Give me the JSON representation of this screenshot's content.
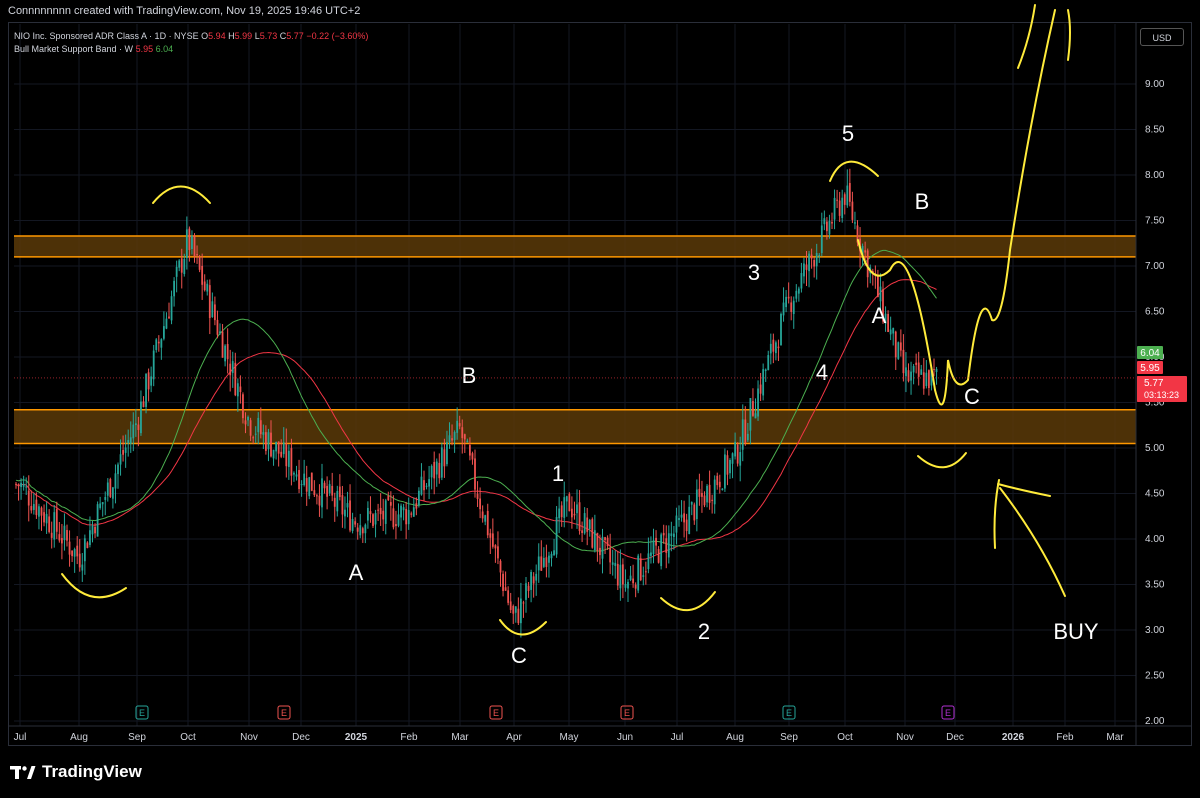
{
  "header": {
    "credit": "Connnnnnnn created with TradingView.com, Nov 19, 2025 19:46 UTC+2"
  },
  "legend": {
    "symbol": "NIO Inc. Sponsored ADR Class A · 1D · NYSE",
    "open_label": "O",
    "open": "5.94",
    "high_label": "H",
    "high": "5.99",
    "low_label": "L",
    "low": "5.73",
    "close_label": "C",
    "close": "5.77",
    "change": "−0.22 (−3.60%)",
    "indicator": "Bull Market Support Band · W",
    "indicator_v1": "5.95",
    "indicator_v2": "6.04"
  },
  "currency": "USD",
  "footer": {
    "brand": "TradingView"
  },
  "colors": {
    "up": "#26a69a",
    "down": "#ef5350",
    "zone_fill": "#5a3a08",
    "zone_line": "#ff9800",
    "sma": "#4caf50",
    "ema": "#f23645",
    "drawing": "#ffeb3b",
    "annotation": "#ffffff"
  },
  "chart_data": {
    "type": "candlestick",
    "symbol": "NIO",
    "timeframe": "1D",
    "x_axis": {
      "tick_labels": [
        "Jul",
        "Aug",
        "Sep",
        "Oct",
        "Nov",
        "Dec",
        "2025",
        "Feb",
        "Mar",
        "Apr",
        "May",
        "Jun",
        "Jul",
        "Aug",
        "Sep",
        "Oct",
        "Nov",
        "Dec",
        "2026",
        "Feb",
        "Mar"
      ]
    },
    "y_axis": {
      "ylim": [
        2.0,
        9.6
      ],
      "tick_labels": [
        "9.00",
        "8.50",
        "8.00",
        "7.50",
        "7.00",
        "6.50",
        "6.00",
        "5.50",
        "5.00",
        "4.50",
        "4.00",
        "3.50",
        "3.00",
        "2.50",
        "2.00"
      ],
      "scale": "linear",
      "position": "right"
    },
    "price_labels": [
      {
        "value": 6.04,
        "text": "6.04",
        "color": "#4caf50"
      },
      {
        "value": 5.95,
        "text": "5.95",
        "color": "#f23645"
      },
      {
        "value": 5.77,
        "text": "5.77",
        "sub": "03:13:23",
        "color": "#f23645"
      }
    ],
    "approx_price_path": [
      {
        "month": "Jul 2024",
        "price": 4.6
      },
      {
        "month": "Aug 2024",
        "price": 3.8
      },
      {
        "month": "Sep 2024",
        "price": 5.3
      },
      {
        "month": "Oct 2024",
        "price": 7.3
      },
      {
        "month": "Nov 2024",
        "price": 5.3
      },
      {
        "month": "Dec 2024",
        "price": 4.7
      },
      {
        "month": "Jan 2025",
        "price": 4.2
      },
      {
        "month": "Feb 2025",
        "price": 4.3
      },
      {
        "month": "Mar 2025",
        "price": 5.2
      },
      {
        "month": "Apr 2025",
        "price": 3.1
      },
      {
        "month": "May 2025",
        "price": 4.4
      },
      {
        "month": "Jun 2025",
        "price": 3.5
      },
      {
        "month": "Jul 2025",
        "price": 4.1
      },
      {
        "month": "Aug 2025",
        "price": 4.9
      },
      {
        "month": "Sep 2025",
        "price": 6.6
      },
      {
        "month": "Oct 2025",
        "price": 7.8
      },
      {
        "month": "Nov 2025",
        "price": 5.77
      }
    ],
    "zones": [
      {
        "low": 7.1,
        "high": 7.33
      },
      {
        "low": 5.05,
        "high": 5.42
      }
    ],
    "annotations": [
      "A",
      "B",
      "C",
      "1",
      "2",
      "3",
      "4",
      "5",
      "A",
      "B",
      "C",
      "BUY"
    ],
    "event_markers": [
      "E",
      "E",
      "E",
      "E",
      "E",
      "E"
    ]
  }
}
